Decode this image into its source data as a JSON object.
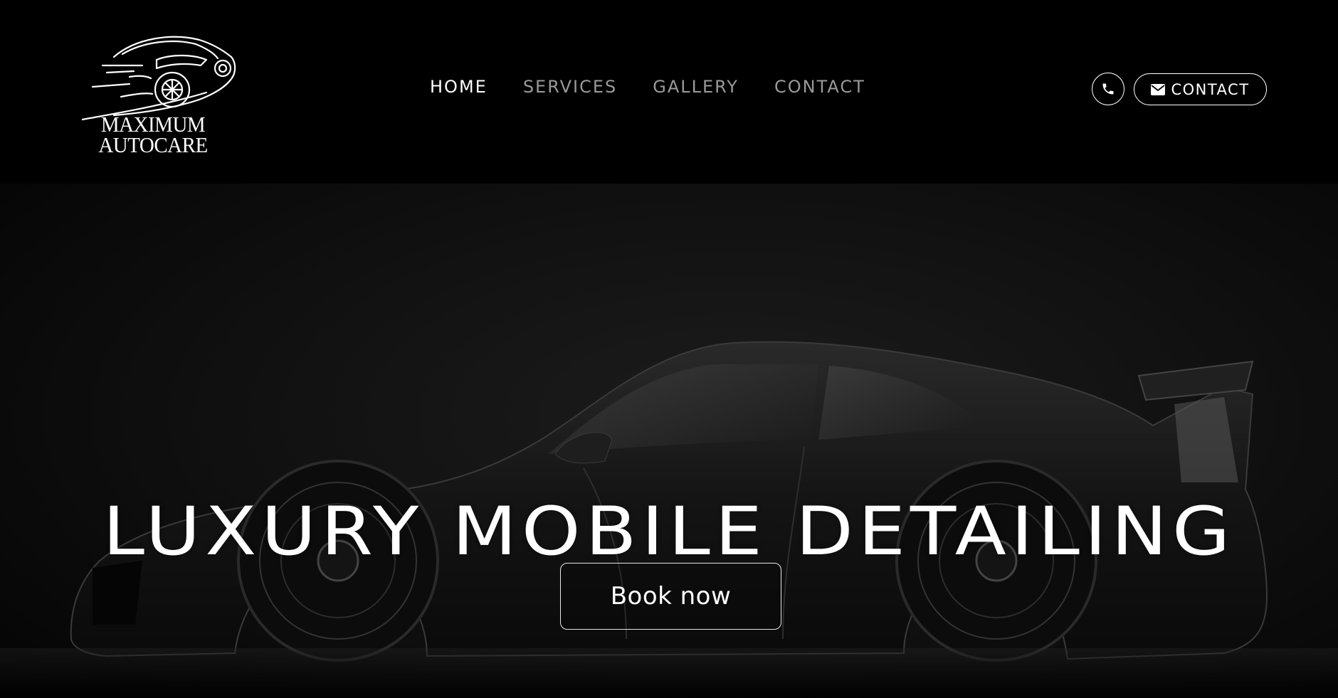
{
  "logo": {
    "line1": "MAXIMUM",
    "line2": "AUTOCARE",
    "icon": "car-outline-logo"
  },
  "nav": {
    "items": [
      {
        "label": "HOME",
        "active": true
      },
      {
        "label": "SERVICES",
        "active": false
      },
      {
        "label": "GALLERY",
        "active": false
      },
      {
        "label": "CONTACT",
        "active": false
      }
    ]
  },
  "header_actions": {
    "phone_icon": "phone-icon",
    "contact_icon": "envelope-icon",
    "contact_label": "CONTACT"
  },
  "hero": {
    "title": "LUXURY MOBILE DETAILING",
    "cta_label": "Book now",
    "background_image": "black sports car side view"
  },
  "colors": {
    "background": "#000000",
    "text": "#ffffff",
    "nav_inactive": "#9a9a9a"
  }
}
